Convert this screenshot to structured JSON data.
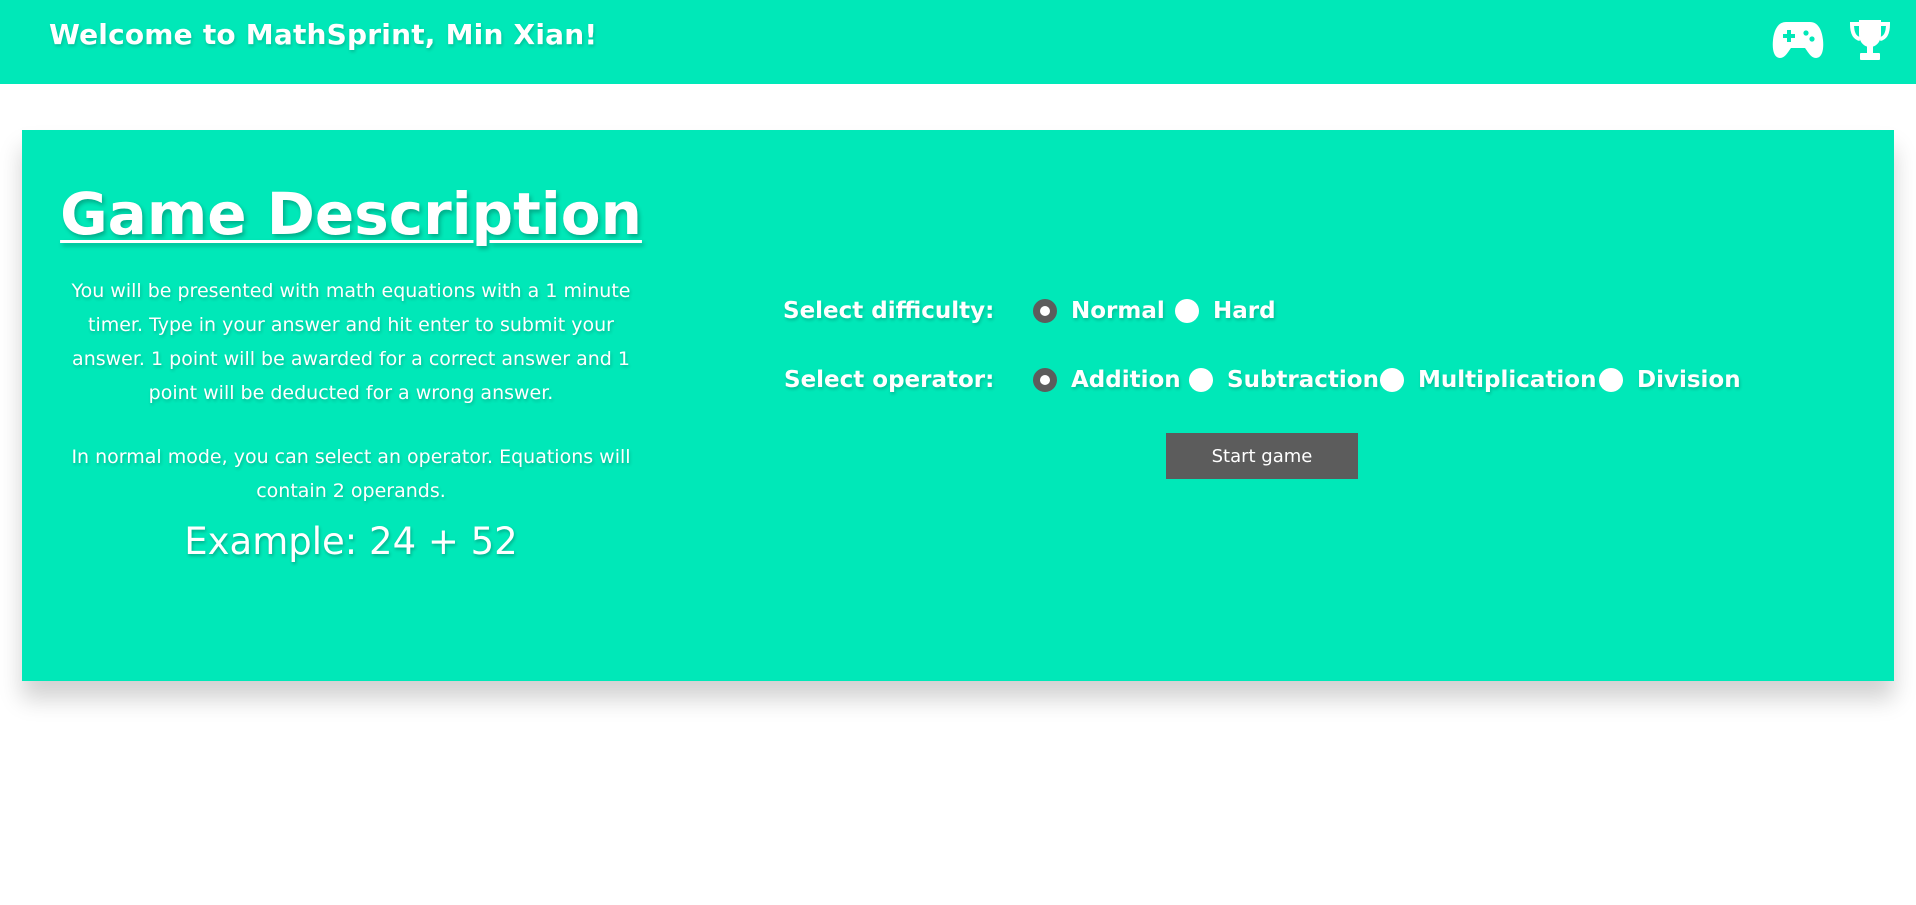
{
  "header": {
    "welcome": "Welcome to MathSprint, Min Xian!",
    "icons": [
      "gamepad-icon",
      "trophy-icon"
    ]
  },
  "description": {
    "title": "Game Description",
    "paragraph1": "You will be presented with math equations with a 1 minute timer. Type in your answer and hit enter to submit your answer. 1 point will be awarded for a correct answer and 1 point will be deducted for a wrong answer.",
    "paragraph2": "In normal mode, you can select an operator. Equations will contain 2 operands.",
    "example": "Example: 24 + 52"
  },
  "settings": {
    "difficulty": {
      "label": "Select difficulty:",
      "options": [
        {
          "label": "Normal",
          "selected": true
        },
        {
          "label": "Hard",
          "selected": false
        }
      ]
    },
    "operator": {
      "label": "Select operator:",
      "options": [
        {
          "label": "Addition",
          "selected": true
        },
        {
          "label": "Subtraction",
          "selected": false
        },
        {
          "label": "Multiplication",
          "selected": false
        },
        {
          "label": "Division",
          "selected": false
        }
      ]
    },
    "start_label": "Start game"
  },
  "colors": {
    "accent": "#00e8b8",
    "button": "#5c5c5c",
    "text": "#ffffff"
  }
}
